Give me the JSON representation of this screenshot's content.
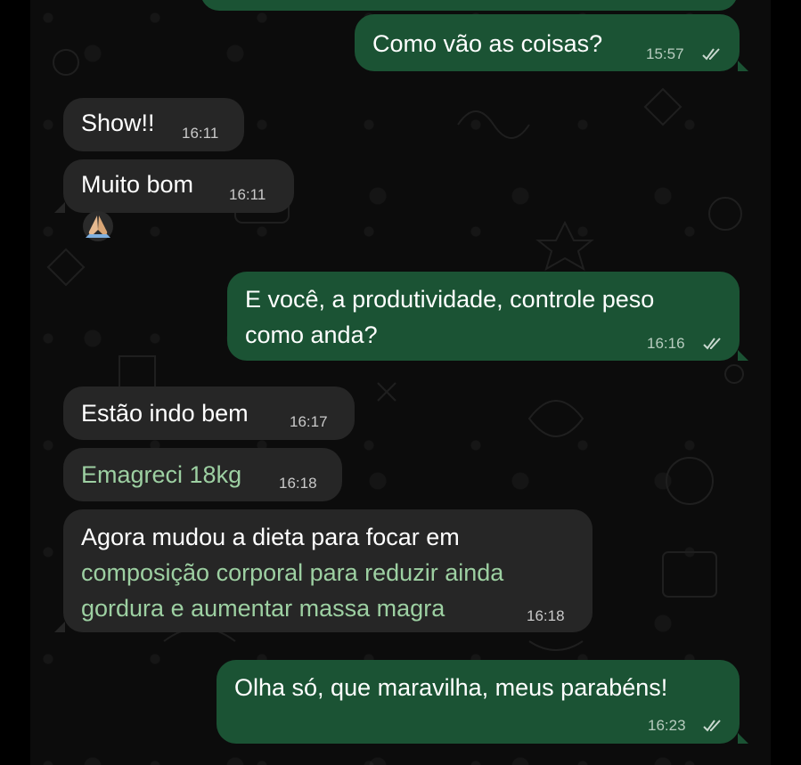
{
  "messages": [
    {
      "id": "m1",
      "direction": "outgoing",
      "text": "Como vão as coisas?",
      "time": "15:57",
      "status": "read"
    },
    {
      "id": "m2",
      "direction": "incoming",
      "text": "Show!!",
      "time": "16:11"
    },
    {
      "id": "m3",
      "direction": "incoming",
      "text": "Muito bom",
      "time": "16:11",
      "reaction": "🙏"
    },
    {
      "id": "m4",
      "direction": "outgoing",
      "lines": [
        "E você, a produtividade, controle peso",
        "como anda?"
      ],
      "time": "16:16",
      "status": "read"
    },
    {
      "id": "m5",
      "direction": "incoming",
      "text": "Estão indo bem",
      "time": "16:17"
    },
    {
      "id": "m6",
      "direction": "incoming",
      "text": "Emagreci 18kg",
      "time": "16:18"
    },
    {
      "id": "m7",
      "direction": "incoming",
      "lines": [
        "Agora mudou a dieta para focar em",
        "composição corporal para reduzir ainda",
        "gordura e aumentar massa magra"
      ],
      "time": "16:18"
    },
    {
      "id": "m8",
      "direction": "outgoing",
      "text": "Olha só, que maravilha, meus parabéns!",
      "time": "16:23",
      "status": "read"
    }
  ],
  "colors": {
    "outgoing_bubble": "#1b5334",
    "incoming_bubble": "#262626",
    "background": "#0c0c0c",
    "read_ticks": "#c9d8cf",
    "highlight_text": "#9dd0a2"
  },
  "icons": {
    "status_read": "double-check-icon",
    "reaction": "folded-hands-emoji"
  }
}
